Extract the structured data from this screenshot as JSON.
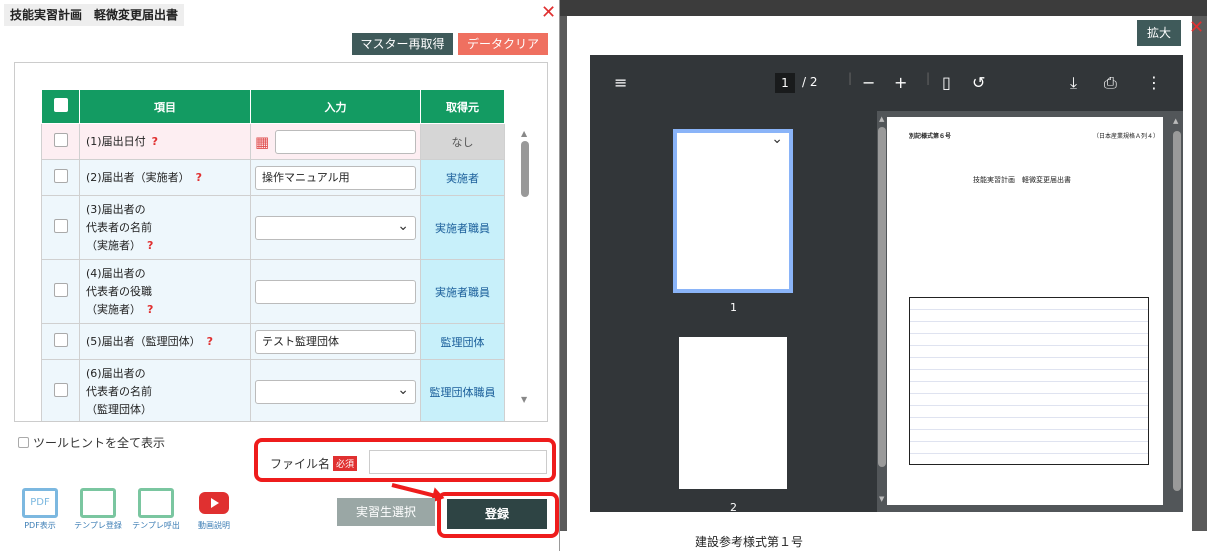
{
  "left_dialog": {
    "title": "技能実習計画　軽微変更届出書",
    "buttons": {
      "master": "マスター再取得",
      "clear": "データクリア"
    },
    "table": {
      "headers": [
        "項目",
        "入力",
        "取得元"
      ],
      "rows": [
        {
          "label_lines": [
            "(1)届出日付"
          ],
          "value": "",
          "source": "なし"
        },
        {
          "label_lines": [
            "(2)届出者（実施者）"
          ],
          "value": "操作マニュアル用",
          "source": "実施者"
        },
        {
          "label_lines": [
            "(3)届出者の",
            "代表者の名前",
            "（実施者）"
          ],
          "value": "",
          "source": "実施者職員"
        },
        {
          "label_lines": [
            "(4)届出者の",
            "代表者の役職",
            "（実施者）"
          ],
          "value": "",
          "source": "実施者職員"
        },
        {
          "label_lines": [
            "(5)届出者（監理団体）"
          ],
          "value": "テスト監理団体",
          "source": "監理団体"
        },
        {
          "label_lines": [
            "(6)届出者の",
            "代表者の名前",
            "（監理団体）"
          ],
          "value": "",
          "source": "監理団体職員"
        }
      ]
    },
    "tooltip_label": "ツールヒントを全て表示",
    "file_label": "ファイル名",
    "required": "必須",
    "icons": [
      "PDF表示",
      "テンプレ登録",
      "テンプレ呼出",
      "動画説明"
    ],
    "pdf_icon_text": "PDF",
    "btn_trainee": "実習生選択",
    "btn_register": "登録"
  },
  "pdf_panel": {
    "expand": "拡大",
    "page_current": "1",
    "page_total": "/ 2",
    "thumb_labels": [
      "1",
      "2"
    ],
    "doc_header": "技能実習計画　軽微変更届出書",
    "form_code": "別記様式第６号",
    "doc_number": "（日本産業規格Ａ列４）"
  },
  "background_text": "建設参考様式第１号",
  "colors": {
    "header_green": "#139b62",
    "close_red": "#e03030",
    "frame_red": "#ee1c1c",
    "dark_btn": "#3f5a5a",
    "orange_btn": "#ef7060"
  }
}
